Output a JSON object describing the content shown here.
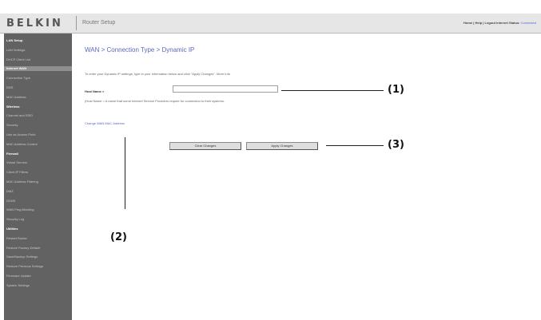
{
  "header": {
    "brand": "BELKIN",
    "title": "Router Setup",
    "links": "Home | Help | Logout",
    "status_label": "Internet Status:",
    "status_value": "Connected"
  },
  "sidebar": {
    "items": [
      {
        "label": "LAN Setup",
        "type": "heading"
      },
      {
        "label": "LAN Settings",
        "type": "link"
      },
      {
        "label": "DHCP Client List",
        "type": "link"
      },
      {
        "label": "Internet WAN",
        "type": "active"
      },
      {
        "label": "Connection Type",
        "type": "link"
      },
      {
        "label": "DNS",
        "type": "link"
      },
      {
        "label": "MAC Address",
        "type": "link"
      },
      {
        "label": "Wireless",
        "type": "heading"
      },
      {
        "label": "Channel and SSID",
        "type": "link"
      },
      {
        "label": "Security",
        "type": "link"
      },
      {
        "label": "Use as Access Point",
        "type": "link"
      },
      {
        "label": "MAC Address Control",
        "type": "link"
      },
      {
        "label": "Firewall",
        "type": "heading"
      },
      {
        "label": "Virtual Servers",
        "type": "link"
      },
      {
        "label": "Client IP Filters",
        "type": "link"
      },
      {
        "label": "MAC Address Filtering",
        "type": "link"
      },
      {
        "label": "DMZ",
        "type": "link"
      },
      {
        "label": "DDNS",
        "type": "link"
      },
      {
        "label": "WAN Ping Blocking",
        "type": "link"
      },
      {
        "label": "Security Log",
        "type": "link"
      },
      {
        "label": "Utilities",
        "type": "heading"
      },
      {
        "label": "Restart Router",
        "type": "link"
      },
      {
        "label": "Restore Factory Default",
        "type": "link"
      },
      {
        "label": "Save/Backup Settings",
        "type": "link"
      },
      {
        "label": "Restore Previous Settings",
        "type": "link"
      },
      {
        "label": "Firmware Update",
        "type": "link"
      },
      {
        "label": "System Settings",
        "type": "link"
      }
    ]
  },
  "main": {
    "title": "WAN > Connection Type > Dynamic IP",
    "intro": "To enter your Dynamic IP settings, type in your information below and click \"Apply Changes\". More Info",
    "host_label": "Host Name >",
    "host_value": "",
    "host_note": "(Host Name = A name that some Internet Service Providers require for connection to their systems.",
    "mac_link": "Change WAN MAC Address",
    "clear_button": "Clear Changes",
    "apply_button": "Apply Changes"
  },
  "callouts": {
    "c1": "(1)",
    "c2": "(2)",
    "c3": "(3)"
  }
}
